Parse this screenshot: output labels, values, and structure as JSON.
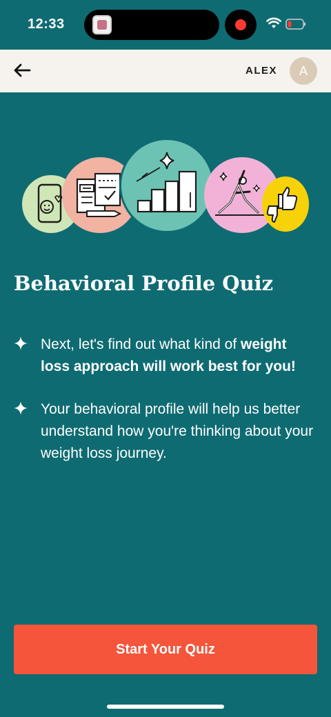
{
  "status_bar": {
    "time": "12:33"
  },
  "header": {
    "user_name": "ALEX",
    "avatar_initial": "A"
  },
  "main": {
    "title": "Behavioral Profile Quiz",
    "bullet_1_prefix": "Next, let's find out what kind of ",
    "bullet_1_bold": "weight loss approach will work best for you!",
    "bullet_2": "Your behavioral profile will help us better understand how you're thinking about your weight loss journey."
  },
  "cta": {
    "label": "Start Your Quiz"
  },
  "colors": {
    "background": "#0f6b72",
    "header_bg": "#f6f3ee",
    "cta": "#f5553a",
    "circle_green": "#cfe6b6",
    "circle_salmon": "#f2b3a3",
    "circle_teal": "#6cc3b4",
    "circle_pink": "#f2b2d8",
    "circle_yellow": "#f7d208"
  }
}
